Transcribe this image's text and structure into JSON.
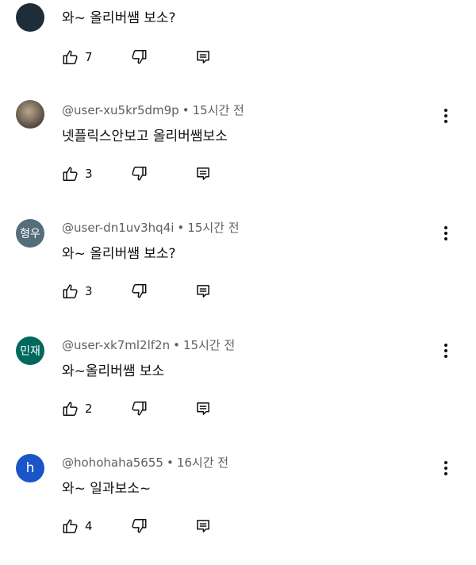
{
  "comments": [
    {
      "username": "",
      "time": "",
      "text": "와~ 올리버쌤 보소?",
      "likes": "7",
      "avatar": {
        "type": "dark-circle",
        "color": "#1f2d3a"
      }
    },
    {
      "username": "@user-xu5kr5dm9p",
      "time": "15시간 전",
      "text": "넷플릭스안보고 올리버쌤보소",
      "likes": "3",
      "avatar": {
        "type": "image",
        "description": "cat"
      }
    },
    {
      "username": "@user-dn1uv3hq4i",
      "time": "15시간 전",
      "text": "와~ 올리버쌤 보소?",
      "likes": "3",
      "avatar": {
        "type": "initials",
        "initials": "형우",
        "color": "#546e7a"
      }
    },
    {
      "username": "@user-xk7ml2lf2n",
      "time": "15시간 전",
      "text": "와~올리버쌤 보소",
      "likes": "2",
      "avatar": {
        "type": "initials",
        "initials": "민재",
        "color": "#00695c"
      }
    },
    {
      "username": "@hohohaha5655",
      "time": "16시간 전",
      "text": "와~ 일과보소~",
      "likes": "4",
      "avatar": {
        "type": "initials",
        "initials": "h",
        "color": "#1a55c8"
      }
    }
  ],
  "icons": {
    "like": "thumbs-up-icon",
    "dislike": "thumbs-down-icon",
    "reply": "reply-comment-icon",
    "menu": "more-vert-icon"
  }
}
